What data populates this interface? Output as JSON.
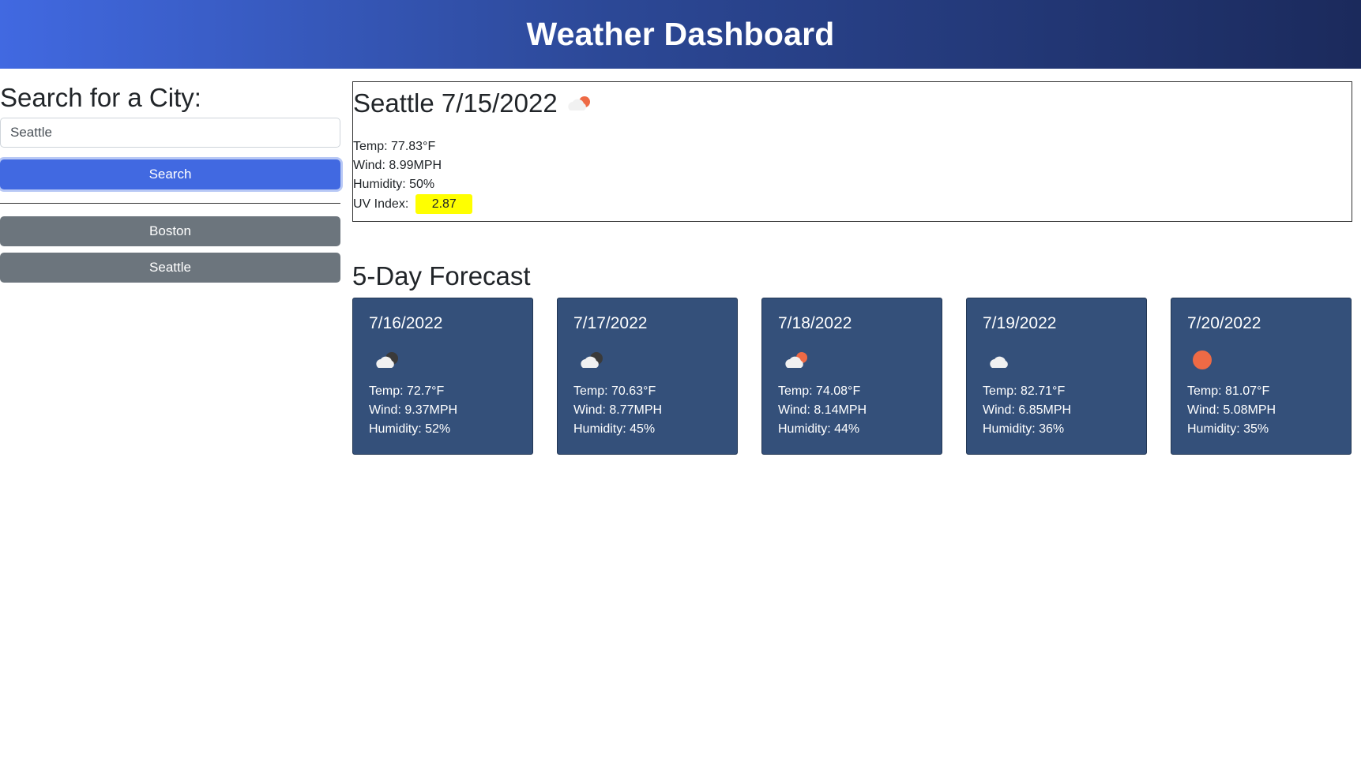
{
  "header": {
    "title": "Weather Dashboard"
  },
  "sidebar": {
    "heading": "Search for a City:",
    "search_value": "Seattle",
    "search_button": "Search",
    "history": [
      {
        "label": "Boston"
      },
      {
        "label": "Seattle"
      }
    ]
  },
  "current": {
    "title": "Seattle 7/15/2022",
    "icon": "cloud-sun-icon",
    "temp": "Temp: 77.83°F",
    "wind": "Wind: 8.99MPH",
    "humidity": "Humidity: 50%",
    "uv_label": "UV Index:",
    "uv_value": "2.87",
    "uv_color": "#ffff00"
  },
  "forecast": {
    "heading": "5-Day Forecast",
    "days": [
      {
        "date": "7/16/2022",
        "icon": "cloud-moon-icon",
        "temp": "Temp: 72.7°F",
        "wind": "Wind: 9.37MPH",
        "humidity": "Humidity: 52%"
      },
      {
        "date": "7/17/2022",
        "icon": "cloud-moon-icon",
        "temp": "Temp: 70.63°F",
        "wind": "Wind: 8.77MPH",
        "humidity": "Humidity: 45%"
      },
      {
        "date": "7/18/2022",
        "icon": "cloud-sun-icon",
        "temp": "Temp: 74.08°F",
        "wind": "Wind: 8.14MPH",
        "humidity": "Humidity: 44%"
      },
      {
        "date": "7/19/2022",
        "icon": "cloud-icon",
        "temp": "Temp: 82.71°F",
        "wind": "Wind: 6.85MPH",
        "humidity": "Humidity: 36%"
      },
      {
        "date": "7/20/2022",
        "icon": "sun-icon",
        "temp": "Temp: 81.07°F",
        "wind": "Wind: 5.08MPH",
        "humidity": "Humidity: 35%"
      }
    ]
  },
  "colors": {
    "accent": "#4169e1",
    "card_bg": "#34507a",
    "history_btn": "#6c757d",
    "sun": "#ee6a45"
  }
}
